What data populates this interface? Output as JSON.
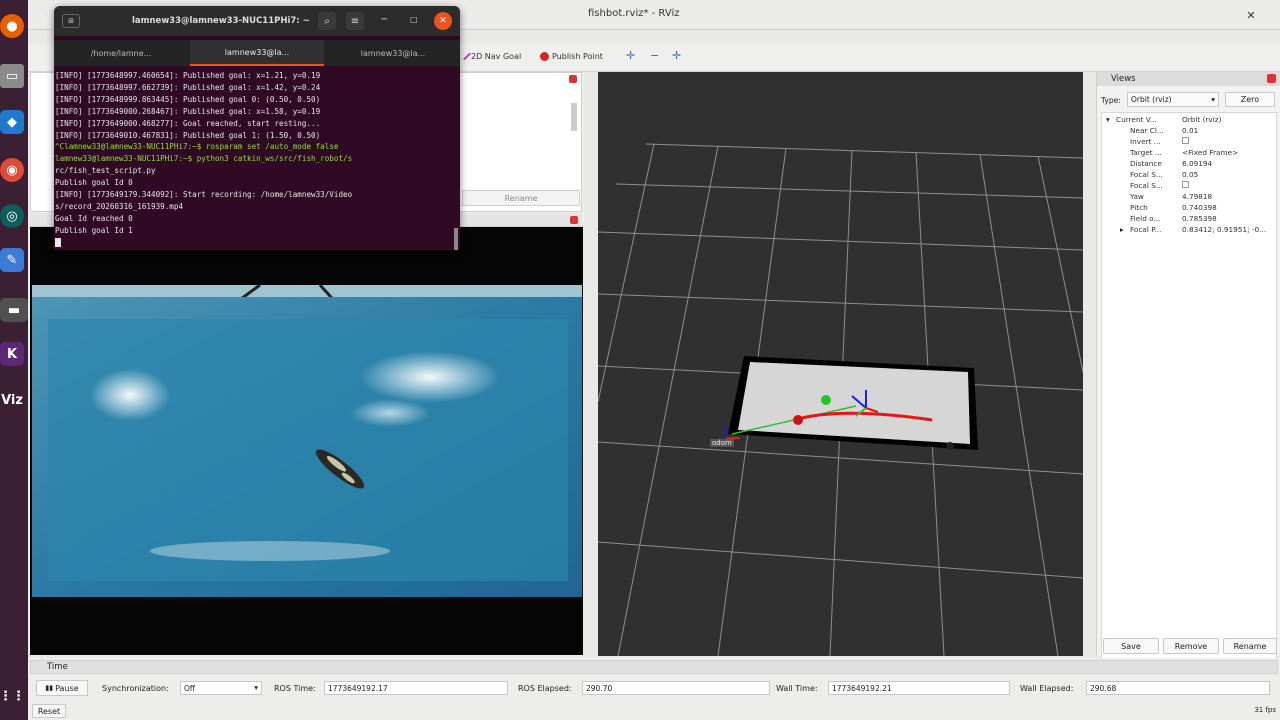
{
  "window": {
    "title": "fishbot.rviz* - RViz"
  },
  "toolbar": {
    "nav_goal": "2D Nav Goal",
    "publish_point": "Publish Point"
  },
  "left_panel": {
    "rename": "Rename"
  },
  "terminal": {
    "title": "lamnew33@lamnew33-NUC11PHi7: ~",
    "tabs": [
      "/home/lamne...",
      "lamnew33@la...",
      "lamnew33@la..."
    ],
    "lines": [
      "[INFO] [1773648997.460654]: Published goal: x=1.21, y=0.19",
      "[INFO] [1773648997.662739]: Published goal: x=1.42, y=0.24",
      "[INFO] [1773648999.863445]: Published goal 0: (0.50, 0.50)",
      "[INFO] [1773649000.268467]: Published goal: x=1.58, y=0.19",
      "[INFO] [1773649000.468277]: Goal reached, start resting...",
      "[INFO] [1773649010.467831]: Published goal 1: (1.50, 0.50)",
      "^Clamnew33@lamnew33-NUC11PHi7:~$ rosparam set /auto_mode false",
      "lamnew33@lamnew33-NUC11PHi7:~$ python3 catkin_ws/src/fish_robot/s",
      "rc/fish_test_script.py",
      "Publish goal Id 0",
      "[INFO] [1773649179.344092]: Start recording: /home/lamnew33/Video",
      "s/record_20260316_161939.mp4",
      "Goal Id reached 0",
      "Publish goal Id 1"
    ]
  },
  "view3d": {
    "frame_label": "odom"
  },
  "views_panel": {
    "title": "Views",
    "type_label": "Type:",
    "type_value": "Orbit (rviz)",
    "zero_button": "Zero",
    "props": [
      {
        "name": "Current V...",
        "value": "Orbit (rviz)"
      },
      {
        "name": "Near Cl...",
        "value": "0.01"
      },
      {
        "name": "Invert ...",
        "value": ""
      },
      {
        "name": "Target ...",
        "value": "<Fixed Frame>"
      },
      {
        "name": "Distance",
        "value": "6.09194"
      },
      {
        "name": "Focal S...",
        "value": "0.05"
      },
      {
        "name": "Focal S...",
        "value": ""
      },
      {
        "name": "Yaw",
        "value": "4.79818"
      },
      {
        "name": "Pitch",
        "value": "0.740398"
      },
      {
        "name": "Field o...",
        "value": "0.785398"
      },
      {
        "name": "Focal P...",
        "value": "0.83412; 0.91951; -0..."
      }
    ],
    "save_button": "Save",
    "remove_button": "Remove",
    "rename_button": "Rename"
  },
  "time_panel": {
    "title": "Time",
    "pause_button": "Pause",
    "sync_label": "Synchronization:",
    "sync_value": "Off",
    "ros_time_label": "ROS Time:",
    "ros_time_value": "1773649192.17",
    "ros_elapsed_label": "ROS Elapsed:",
    "ros_elapsed_value": "290.70",
    "wall_time_label": "Wall Time:",
    "wall_time_value": "1773649192.21",
    "wall_elapsed_label": "Wall Elapsed:",
    "wall_elapsed_value": "290.68",
    "reset_button": "Reset",
    "fps": "31 fps"
  },
  "colors": {
    "dock": "#3b1f33",
    "terminal_bg": "#300a24",
    "ubuntu_orange": "#e95420",
    "grid_bg": "#303030"
  }
}
